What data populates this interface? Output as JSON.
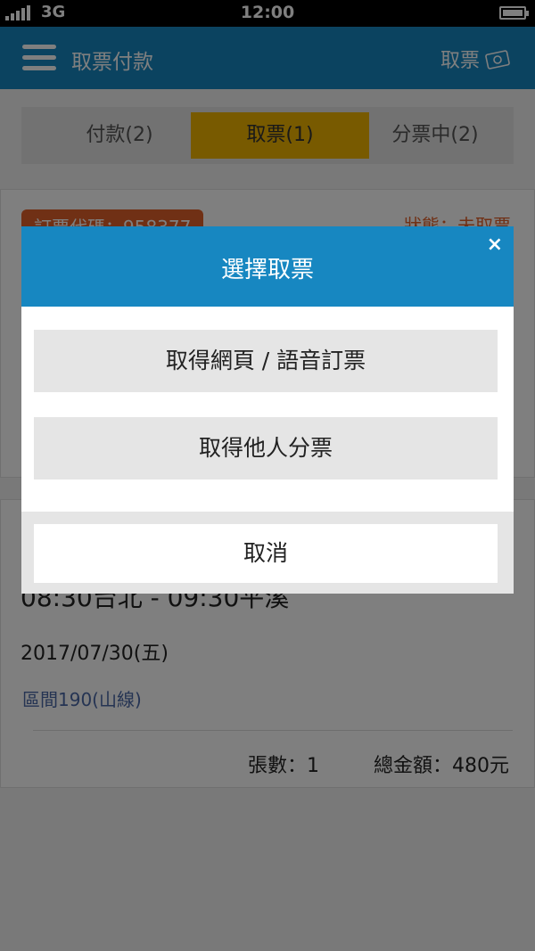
{
  "status_bar": {
    "network": "3G",
    "time": "12:00"
  },
  "app_bar": {
    "title": "取票付款",
    "action_label": "取票"
  },
  "tabs": [
    {
      "label": "付款(2)"
    },
    {
      "label": "取票(1)",
      "active": true
    },
    {
      "label": "分票中(2)"
    }
  ],
  "order": {
    "code_label": "訂票代碼：958377",
    "status_label": "狀態：未取票"
  },
  "trip": {
    "route": "08:30台北 - 09:30平溪",
    "date": "2017/07/30(五)",
    "train": "區間190(山線)",
    "quantity": "張數：1",
    "total": "總金額：480元"
  },
  "modal": {
    "title": "選擇取票",
    "close_label": "×",
    "option_web_voice": "取得網頁 / 語音訂票",
    "option_others": "取得他人分票",
    "cancel_label": "取消"
  },
  "colors": {
    "primary": "#1787c1",
    "active_tab": "#f0b400",
    "badge": "#e0602b",
    "train_link": "#4b68a6"
  }
}
